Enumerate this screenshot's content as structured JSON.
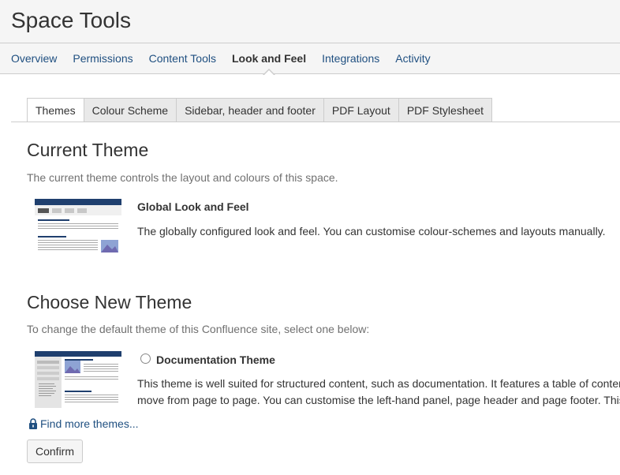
{
  "header": {
    "title": "Space Tools",
    "nav": [
      {
        "label": "Overview",
        "active": false
      },
      {
        "label": "Permissions",
        "active": false
      },
      {
        "label": "Content Tools",
        "active": false
      },
      {
        "label": "Look and Feel",
        "active": true
      },
      {
        "label": "Integrations",
        "active": false
      },
      {
        "label": "Activity",
        "active": false
      }
    ]
  },
  "tabs": [
    {
      "label": "Themes",
      "active": true
    },
    {
      "label": "Colour Scheme",
      "active": false
    },
    {
      "label": "Sidebar, header and footer",
      "active": false
    },
    {
      "label": "PDF Layout",
      "active": false
    },
    {
      "label": "PDF Stylesheet",
      "active": false
    }
  ],
  "current_theme": {
    "heading": "Current Theme",
    "description": "The current theme controls the layout and colours of this space.",
    "name": "Global Look and Feel",
    "details": "The globally configured look and feel. You can customise colour-schemes and layouts manually.",
    "thumbnail_icon": "global-theme-thumbnail"
  },
  "choose_theme": {
    "heading": "Choose New Theme",
    "description": "To change the default theme of this Confluence site, select one below:",
    "options": [
      {
        "name": "Documentation Theme",
        "selected": false,
        "details_line1": "This theme is well suited for structured content, such as documentation. It features a table of contents",
        "details_line2": "move from page to page. You can customise the left-hand panel, page header and page footer. This",
        "thumbnail_icon": "documentation-theme-thumbnail"
      }
    ]
  },
  "links": {
    "find_more": "Find more themes...",
    "find_more_icon": "lock-icon"
  },
  "buttons": {
    "confirm": "Confirm"
  },
  "colors": {
    "link": "#205081",
    "thumb_header": "#1f3f6e",
    "header_bg": "#f5f5f5"
  }
}
